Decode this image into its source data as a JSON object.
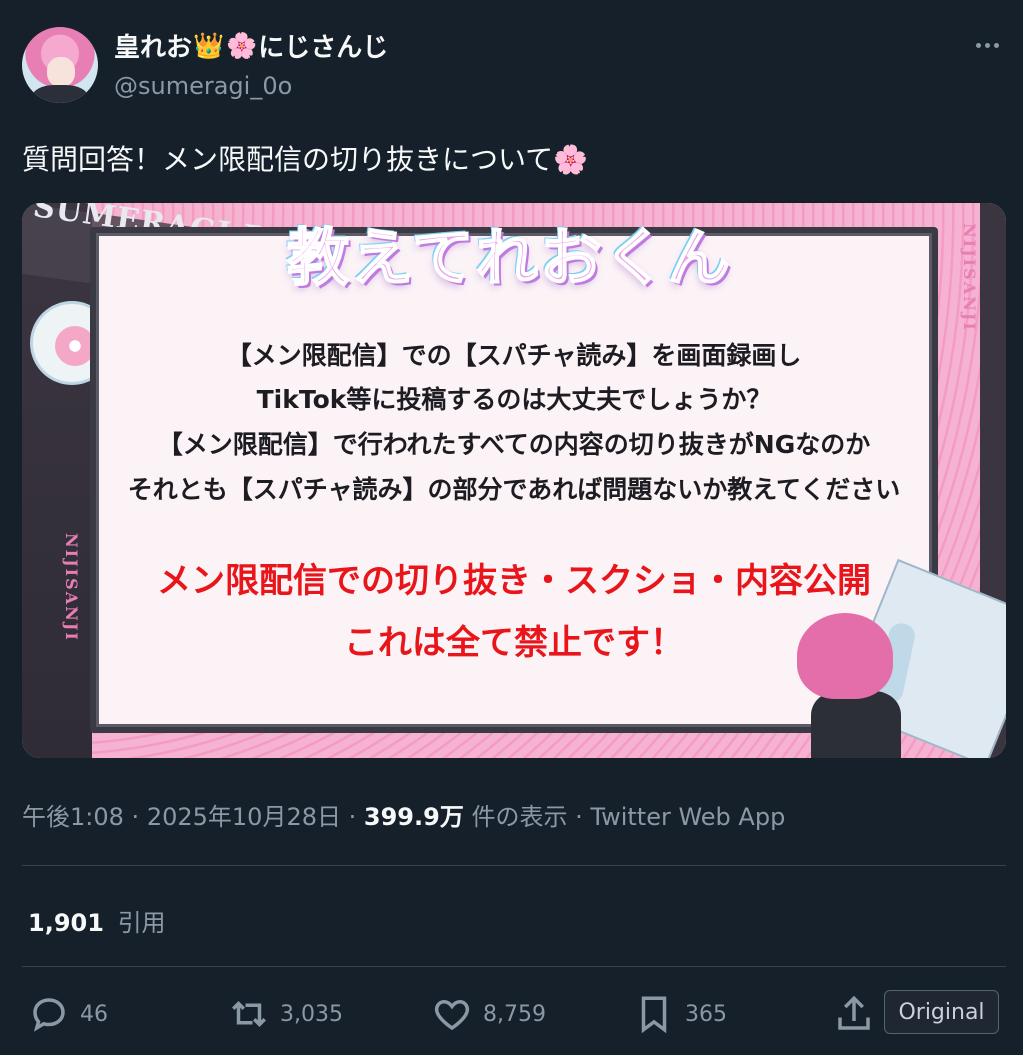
{
  "author": {
    "display_name": "皇れお",
    "display_suffix": "にじさんじ",
    "emoji_crown": "👑",
    "emoji_flower": "🌸",
    "handle": "@sumeragi_0o"
  },
  "tweet": {
    "text": "質問回答！メン限配信の切り抜きについて",
    "text_emoji": "🌸"
  },
  "media": {
    "banner_text": "SUMERAGI REO",
    "side_text": "NIJISANJI",
    "title": "教えてれおくん",
    "question_lines": [
      "【メン限配信】での【スパチャ読み】を画面録画し",
      "TikTok等に投稿するのは大丈夫でしょうか？",
      "【メン限配信】で行われたすべての内容の切り抜きがNGなのか",
      "それとも【スパチャ読み】の部分であれば問題ないか教えてください"
    ],
    "answer_lines": [
      "メン限配信での切り抜き・スクショ・内容公開",
      "これは全て禁止です！"
    ]
  },
  "meta": {
    "time": "午後1:08",
    "date": "2025年10月28日",
    "views": "399.9万",
    "views_label": "件の表示",
    "source": "Twitter Web App",
    "separator": "·"
  },
  "quotes": {
    "count": "1,901",
    "label": "引用"
  },
  "actions": {
    "replies": "46",
    "retweets": "3,035",
    "likes": "8,759",
    "bookmarks": "365",
    "original_label": "Original"
  },
  "colors": {
    "background": "#15202b",
    "text_primary": "#f7f9f9",
    "text_secondary": "#8b98a5",
    "answer_red": "#e8161b"
  },
  "icons": [
    "more-icon",
    "reply-icon",
    "retweet-icon",
    "like-icon",
    "bookmark-icon",
    "share-icon"
  ]
}
